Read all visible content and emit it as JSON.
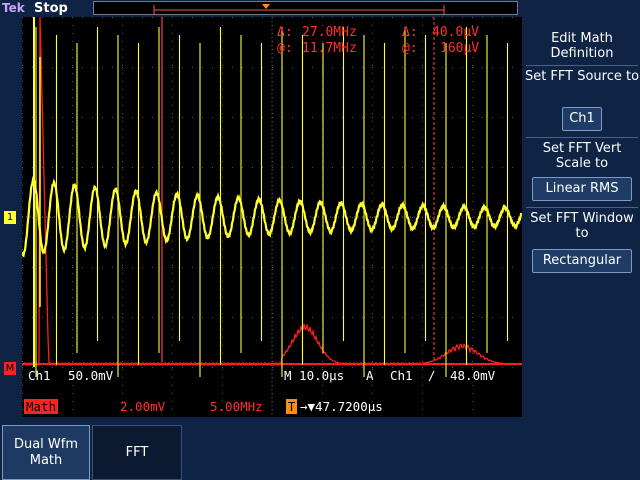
{
  "brand": "Tek",
  "acq_state": "Stop",
  "readouts": {
    "delta_label": "Δ:",
    "at_label": "@:",
    "freq_delta": "27.0MHz",
    "freq_at": "11.7MHz",
    "volt_delta": "40.0µV",
    "volt_at": "160µV"
  },
  "channel_info": {
    "ch1": "Ch1",
    "ch1_scale": "50.0mV",
    "timebase": "M 10.0µs",
    "trigger_mode": "A",
    "trigger_source": "Ch1",
    "trigger_slope": "∕",
    "trigger_level": "48.0mV",
    "math_label": "Math",
    "math_scale": "2.00mV",
    "math_freq": "5.00MHz",
    "trigger_pos": "→▼47.7200µs"
  },
  "markers": {
    "ch1_marker": "1",
    "math_marker": "M",
    "trigger_marker": "T"
  },
  "side_menu": {
    "item1_title": "Edit Math Definition",
    "item2_title": "Set FFT Source to",
    "item2_value": "Ch1",
    "item3_title": "Set FFT Vert Scale to",
    "item3_value": "Linear RMS",
    "item4_title": "Set FFT Window to",
    "item4_value": "Rectangular"
  },
  "bottom_menu": {
    "dual_wfm_math": "Dual Wfm Math",
    "fft": "FFT"
  },
  "colors": {
    "ch1_trace": "#ffff33",
    "math_trace": "#ff1e1e",
    "background": "#0f2344",
    "screen": "#000000"
  }
}
